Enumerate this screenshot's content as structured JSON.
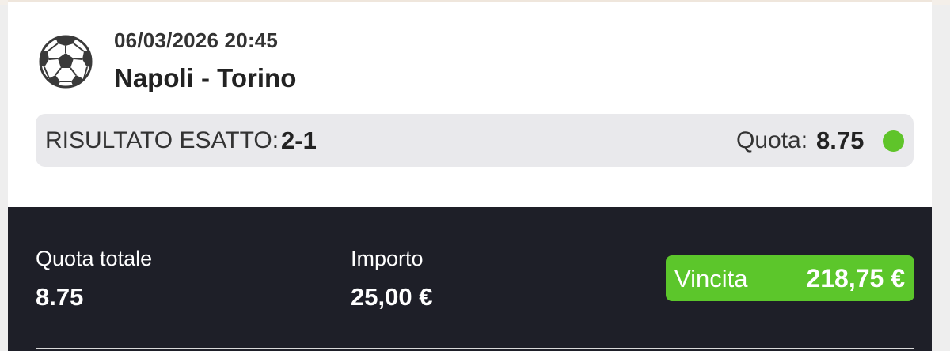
{
  "event": {
    "date_time": "06/03/2026 20:45",
    "teams": "Napoli - Torino",
    "icon": "soccer-ball-icon"
  },
  "selection": {
    "market_label": "RISULTATO ESATTO:",
    "market_value": "2-1",
    "odds_label": "Quota:",
    "odds_value": "8.75",
    "status": "winning",
    "status_color": "#5fc42a"
  },
  "summary": {
    "total_odds_label": "Quota totale",
    "total_odds_value": "8.75",
    "stake_label": "Importo",
    "stake_value": "25,00 €",
    "win_label": "Vincita",
    "win_value": "218,75 €",
    "win_color": "#5cc62b",
    "background_color": "#1e1f28"
  }
}
